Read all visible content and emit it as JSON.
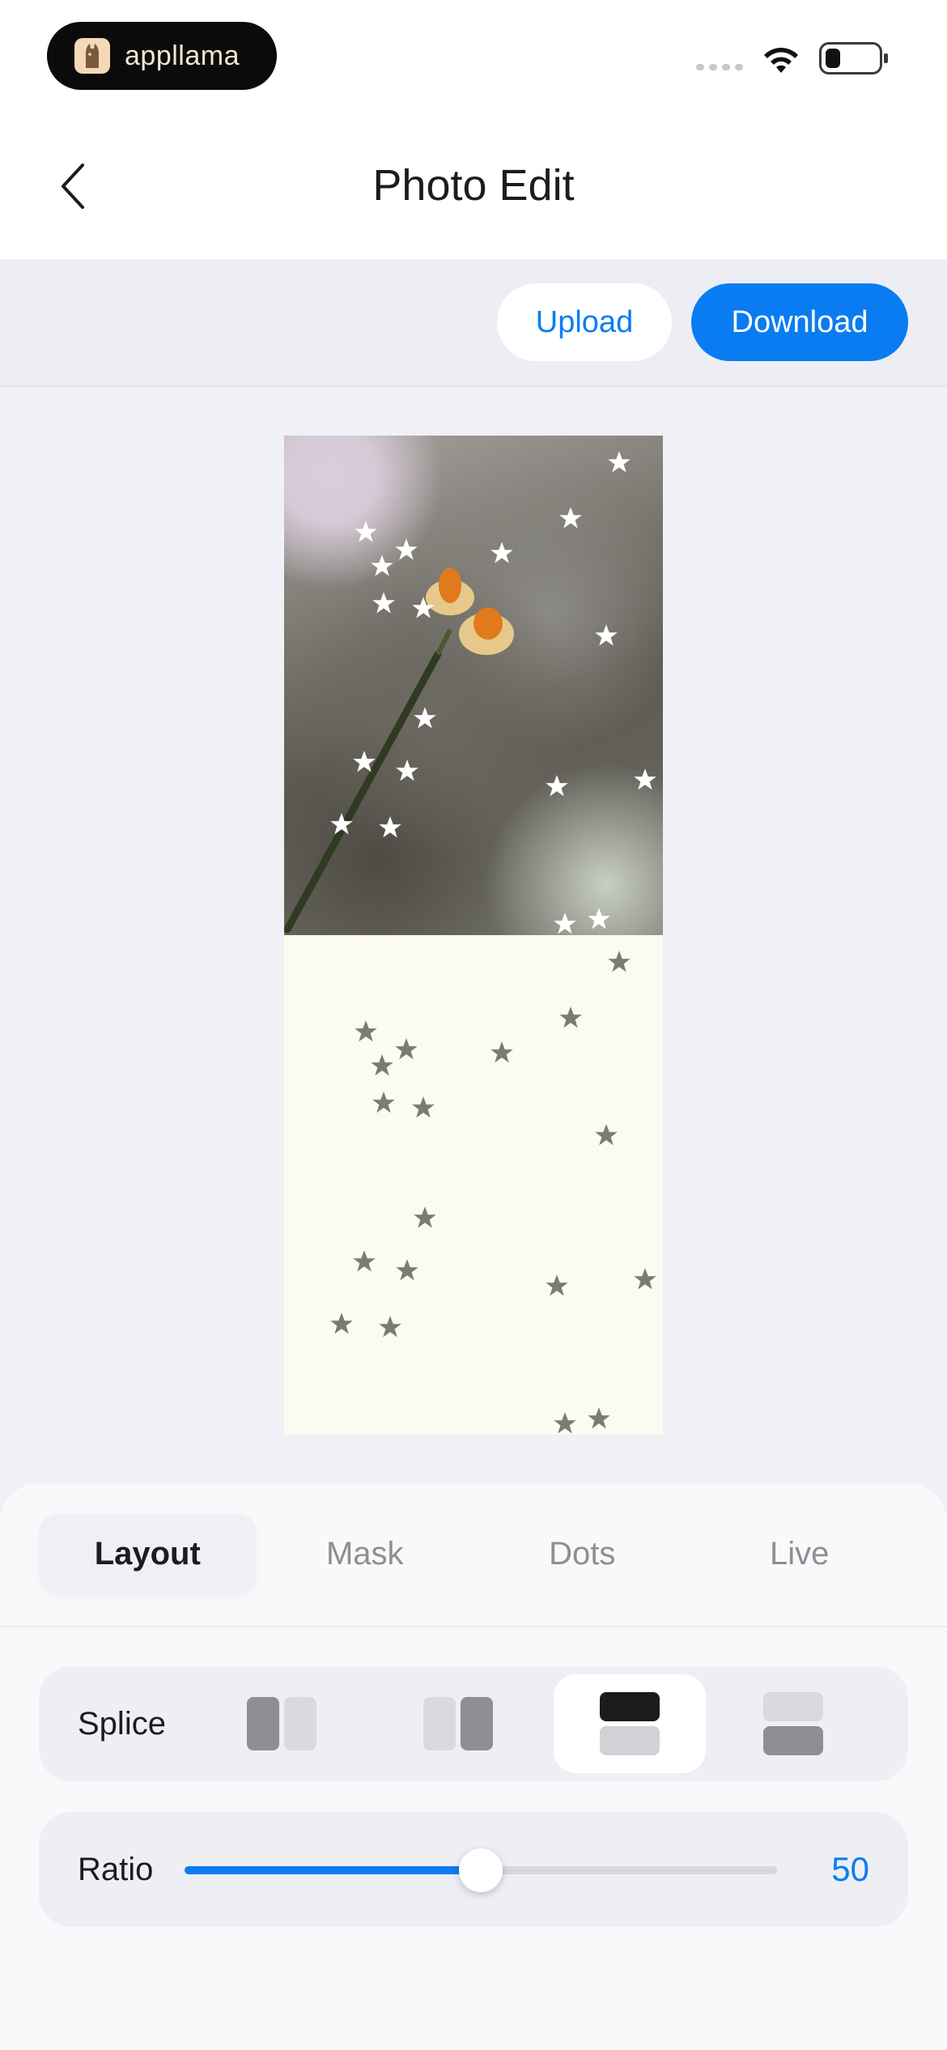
{
  "status_bar": {
    "brand": "appllama",
    "brand_icon": "llama-icon",
    "wifi_icon": "wifi-icon",
    "battery_icon": "battery-icon"
  },
  "nav": {
    "title": "Photo Edit",
    "back_icon": "chevron-left-icon"
  },
  "actions": {
    "upload_label": "Upload",
    "download_label": "Download"
  },
  "colors": {
    "accent": "#0a7cf2",
    "background": "#f0f1f6",
    "panel": "#f9f9fb"
  },
  "tabs": [
    {
      "label": "Layout",
      "active": true
    },
    {
      "label": "Mask",
      "active": false
    },
    {
      "label": "Dots",
      "active": false
    },
    {
      "label": "Live",
      "active": false
    }
  ],
  "splice": {
    "label": "Splice",
    "options": [
      {
        "name": "split-left-dark",
        "selected": false
      },
      {
        "name": "split-right-dark",
        "selected": false
      },
      {
        "name": "split-top-dark",
        "selected": true
      },
      {
        "name": "split-bottom-dark",
        "selected": false
      }
    ]
  },
  "ratio": {
    "label": "Ratio",
    "value": "50",
    "fraction": 0.5
  }
}
